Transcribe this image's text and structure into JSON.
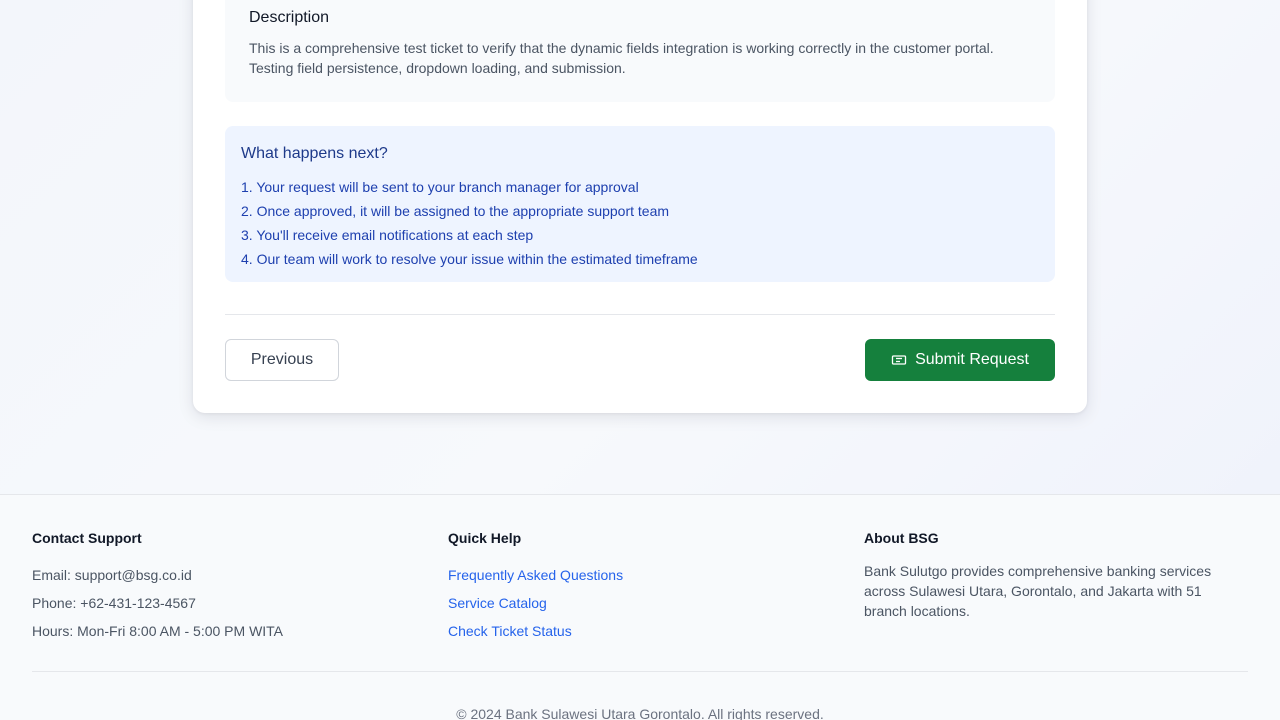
{
  "description": {
    "title": "Description",
    "text": "This is a comprehensive test ticket to verify that the dynamic fields integration is working correctly in the customer portal. Testing field persistence, dropdown loading, and submission."
  },
  "next_steps": {
    "title": "What happens next?",
    "items": [
      "1. Your request will be sent to your branch manager for approval",
      "2. Once approved, it will be assigned to the appropriate support team",
      "3. You'll receive email notifications at each step",
      "4. Our team will work to resolve your issue within the estimated timeframe"
    ]
  },
  "actions": {
    "previous_label": "Previous",
    "submit_label": "Submit Request",
    "submit_icon": "ticket-icon"
  },
  "footer": {
    "contact": {
      "title": "Contact Support",
      "email": "Email: support@bsg.co.id",
      "phone": "Phone: +62-431-123-4567",
      "hours": "Hours: Mon-Fri 8:00 AM - 5:00 PM WITA"
    },
    "quick_help": {
      "title": "Quick Help",
      "links": [
        "Frequently Asked Questions",
        "Service Catalog",
        "Check Ticket Status"
      ]
    },
    "about": {
      "title": "About BSG",
      "text": "Bank Sulutgo provides comprehensive banking services across Sulawesi Utara, Gorontalo, and Jakarta with 51 branch locations."
    },
    "copyright": "© 2024 Bank Sulawesi Utara Gorontalo. All rights reserved."
  },
  "colors": {
    "submit_bg": "#15803d",
    "link": "#2563eb",
    "info_bg": "#eef4ff",
    "info_text": "#1e40af"
  }
}
